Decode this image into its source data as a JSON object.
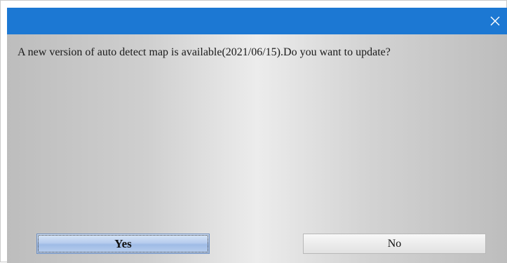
{
  "dialog": {
    "message": "A new version of auto detect map is available(2021/06/15).Do you want to update?",
    "close_icon": "close-icon",
    "buttons": {
      "yes_label": "Yes",
      "no_label": "No"
    }
  },
  "colors": {
    "titlebar": "#1c78d3",
    "background_gradient": [
      "#bdbdbd",
      "#ececec",
      "#bdbdbd"
    ],
    "yes_button": "#b7cdee"
  }
}
